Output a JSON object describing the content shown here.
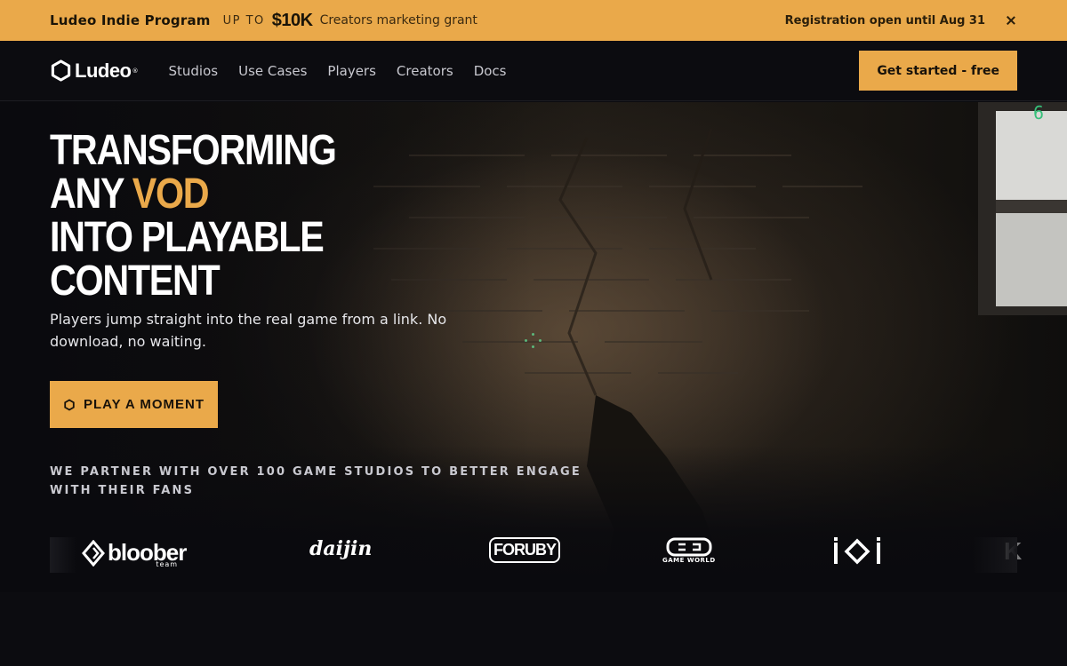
{
  "promo": {
    "program": "Ludeo Indie Program",
    "upto": "UP TO",
    "amount": "$10K",
    "grant": "Creators marketing grant",
    "registration": "Registration open until Aug 31"
  },
  "nav": {
    "brand": "Ludeo",
    "links": [
      "Studios",
      "Use Cases",
      "Players",
      "Creators",
      "Docs"
    ],
    "cta": "Get started - free"
  },
  "hero": {
    "line1": "TRANSFORMING",
    "line2a": "ANY",
    "line2b": "VOD",
    "line3": "INTO PLAYABLE",
    "line4": "CONTENT",
    "subtitle": "Players jump straight into the real game from a link. No download, no waiting.",
    "button": "PLAY A MOMENT",
    "ammo": "6"
  },
  "partners": {
    "text": "WE PARTNER WITH OVER 100 GAME STUDIOS TO BETTER ENGAGE WITH THEIR FANS",
    "logos": [
      "bloober",
      "team",
      "daijin",
      "FORUBY",
      "GAME WORLD",
      "ioi",
      "K"
    ]
  },
  "colors": {
    "accent": "#eaa94a",
    "background": "#0b0b0f",
    "ammo": "#36c07a"
  }
}
